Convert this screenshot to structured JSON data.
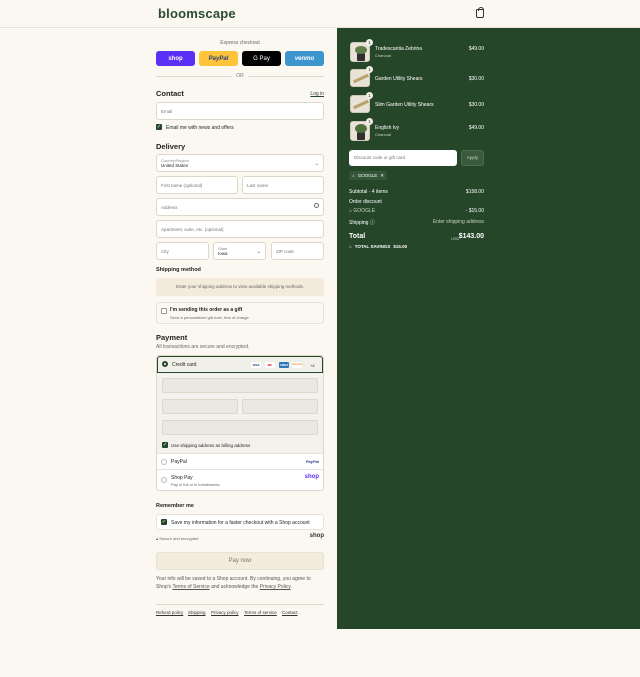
{
  "header": {
    "logo": "bloomscape",
    "cart_icon": "shopping-bag-icon"
  },
  "express": {
    "label": "Express checkout",
    "buttons": [
      {
        "label": "shop",
        "color": "#5a31f4"
      },
      {
        "label": "PayPal",
        "color": "#ffc439"
      },
      {
        "label": "G Pay",
        "color": "#000000"
      },
      {
        "label": "venmo",
        "color": "#3d95ce"
      }
    ],
    "or": "OR"
  },
  "contact": {
    "title": "Contact",
    "login": "Log in",
    "email_placeholder": "Email",
    "news_label": "Email me with news and offers"
  },
  "delivery": {
    "title": "Delivery",
    "country_label": "Country/Region",
    "country_value": "United States",
    "first_name": "First name (optional)",
    "last_name": "Last name",
    "address": "Address",
    "apartment": "Apartment, suite, etc. (optional)",
    "city": "City",
    "state_label": "State",
    "state_value": "Iowa",
    "zip": "ZIP code"
  },
  "shipping_method": {
    "title": "Shipping method",
    "notice": "Enter your shipping address to view available shipping methods."
  },
  "gift": {
    "title": "I'm sending this order as a gift",
    "subtitle": "Send a personalized gift note, free of charge"
  },
  "payment": {
    "title": "Payment",
    "subtitle": "All transactions are secure and encrypted.",
    "credit_card": "Credit card",
    "cards": [
      "VISA",
      "MC",
      "AMEX",
      "DISCOVER"
    ],
    "more_cards": "+4",
    "billing_label": "Use shipping address as billing address",
    "paypal": "PayPal",
    "paypal_logo": "PayPal",
    "shop_pay": "Shop Pay",
    "shop_pay_sub": "Pay in full or in installments",
    "shop_pay_logo": "shop"
  },
  "remember": {
    "title": "Remember me",
    "save_label": "Save my information for a faster checkout with a Shop account",
    "secure": "Secure and encrypted",
    "shop_logo": "shop"
  },
  "pay_now": "Pay now",
  "legal": {
    "line1": "Your info will be saved to a Shop account. By continuing, you agree to Shop's",
    "terms": "Terms of Service",
    "and": "and acknowledge the",
    "privacy": "Privacy Policy",
    "period": "."
  },
  "footer_links": [
    "Refund policy",
    "Shipping",
    "Privacy policy",
    "Terms of service",
    "Contact"
  ],
  "summary": {
    "items": [
      {
        "name": "Tradescantia Zebrina",
        "variant": "Charcoal",
        "price": "$49.00",
        "qty": "1"
      },
      {
        "name": "Garden Utility Shears",
        "variant": "",
        "price": "$30.00",
        "qty": "1"
      },
      {
        "name": "Slim Garden Utility Shears",
        "variant": "",
        "price": "$30.00",
        "qty": "1"
      },
      {
        "name": "English Ivy",
        "variant": "Charcoal",
        "price": "$49.00",
        "qty": "1"
      }
    ],
    "discount_placeholder": "Discount code or gift card",
    "apply": "Apply",
    "code_tag": "GOOGLE",
    "subtotal_label": "Subtotal · 4 items",
    "subtotal_value": "$158.00",
    "order_discount": "Order discount",
    "discount_code": "GOOGLE",
    "discount_value": "- $15.00",
    "shipping_label": "Shipping",
    "shipping_value": "Enter shipping address",
    "total_label": "Total",
    "currency": "USD",
    "total_value": "$143.00",
    "savings_label": "TOTAL SAVINGS",
    "savings_value": "$15.00"
  },
  "colors": {
    "accent": "#26462a",
    "background": "#fbf8f1"
  }
}
